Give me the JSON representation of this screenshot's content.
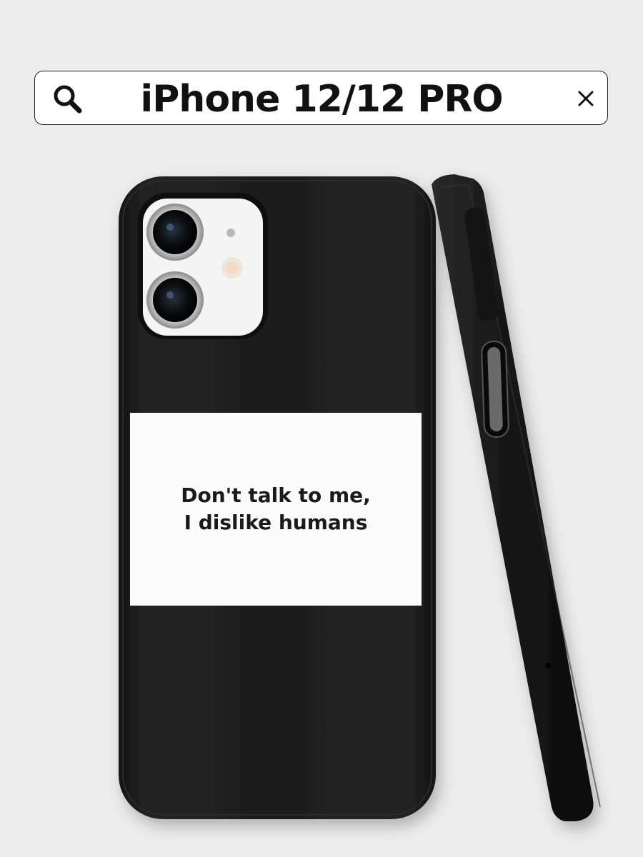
{
  "search": {
    "query": "iPhone 12/12 PRO",
    "search_icon": "search-icon",
    "clear_icon": "close-icon"
  },
  "product": {
    "case_print_line1": "Don't talk to me,",
    "case_print_line2": "I dislike humans",
    "case_color": "#1c1c1e",
    "print_background": "#fbfbfb"
  }
}
